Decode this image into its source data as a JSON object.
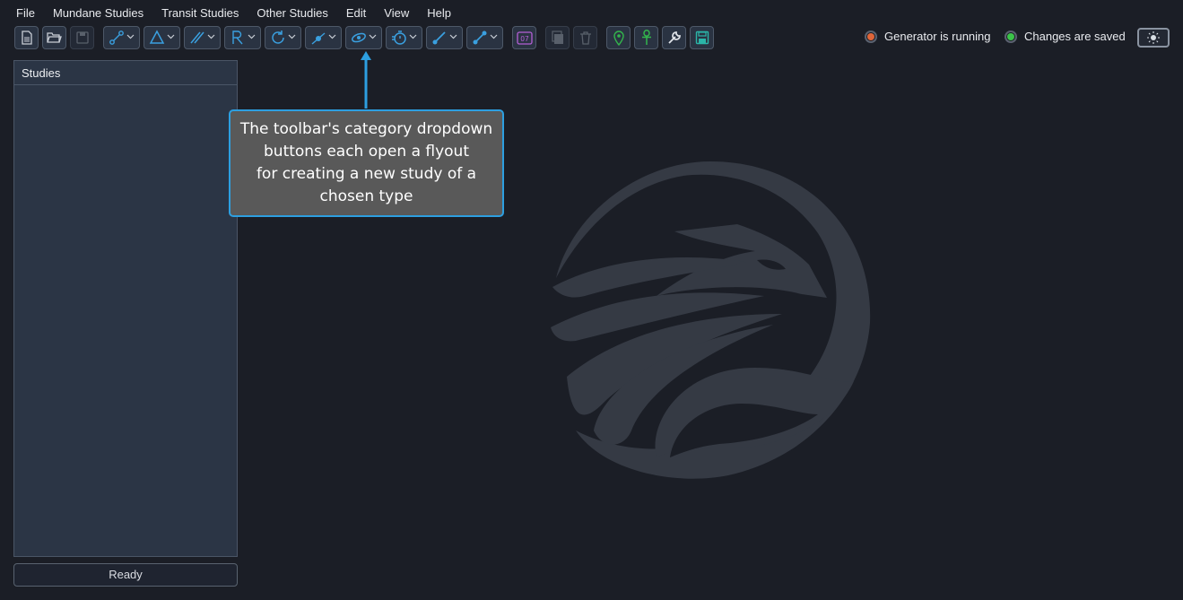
{
  "menu": [
    "File",
    "Mundane Studies",
    "Transit Studies",
    "Other Studies",
    "Edit",
    "View",
    "Help"
  ],
  "toolbar": {
    "icons": {
      "new": "new-document-icon",
      "open": "open-folder-icon",
      "save": "save-disk-icon",
      "pdf": "pdf-export-icon",
      "delete": "trash-icon",
      "location": "map-pin-icon",
      "ankh": "ankh-icon",
      "settings": "wrench-icon",
      "save_all": "save-all-icon",
      "calendar_day": "07"
    }
  },
  "status": {
    "generator": "Generator is running",
    "generator_color": "#e0663a",
    "saved": "Changes are saved",
    "saved_color": "#3cc44a"
  },
  "panel": {
    "title": "Studies"
  },
  "status_bar": {
    "ready": "Ready"
  },
  "tooltip": {
    "lines": [
      "The toolbar's category dropdown",
      "buttons each open a flyout",
      "for creating a new study of a",
      "chosen type"
    ]
  },
  "colors": {
    "background": "#1b1e26",
    "accent": "#2d9fe0",
    "panel": "#2b3545"
  }
}
